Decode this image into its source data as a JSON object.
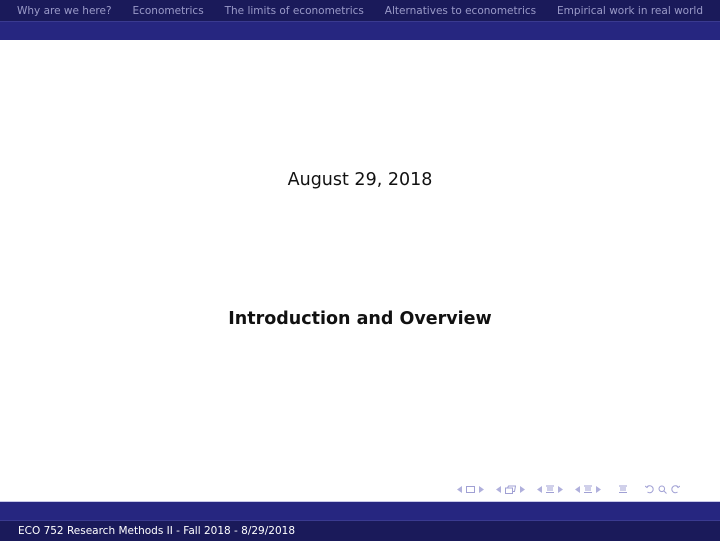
{
  "navigation": {
    "sections": [
      {
        "label": "Why are we here?"
      },
      {
        "label": "Econometrics"
      },
      {
        "label": "The limits of econometrics"
      },
      {
        "label": "Alternatives to econometrics"
      },
      {
        "label": "Empirical work in real world"
      }
    ]
  },
  "slide": {
    "date": "August 29, 2018",
    "title": "Introduction and Overview"
  },
  "beamer_controls": {
    "icons": [
      "prev-arrow-icon",
      "frame-icon",
      "next-arrow-icon",
      "prev-arrow-icon",
      "subsection-icon",
      "next-arrow-icon",
      "prev-arrow-icon",
      "section-icon",
      "next-arrow-icon",
      "prev-arrow-icon",
      "presentation-icon",
      "next-arrow-icon",
      "outline-icon",
      "back-icon",
      "search-icon",
      "forward-icon"
    ]
  },
  "footer": {
    "text": "ECO 752 Research Methods II - Fall 2018 - 8/29/2018"
  },
  "colors": {
    "header_dark": "#1a1a5a",
    "header_band": "#262680",
    "nav_text": "#9a9ac8",
    "footer_text": "#ffffff",
    "nav_symbols": "#b0b0dc"
  }
}
